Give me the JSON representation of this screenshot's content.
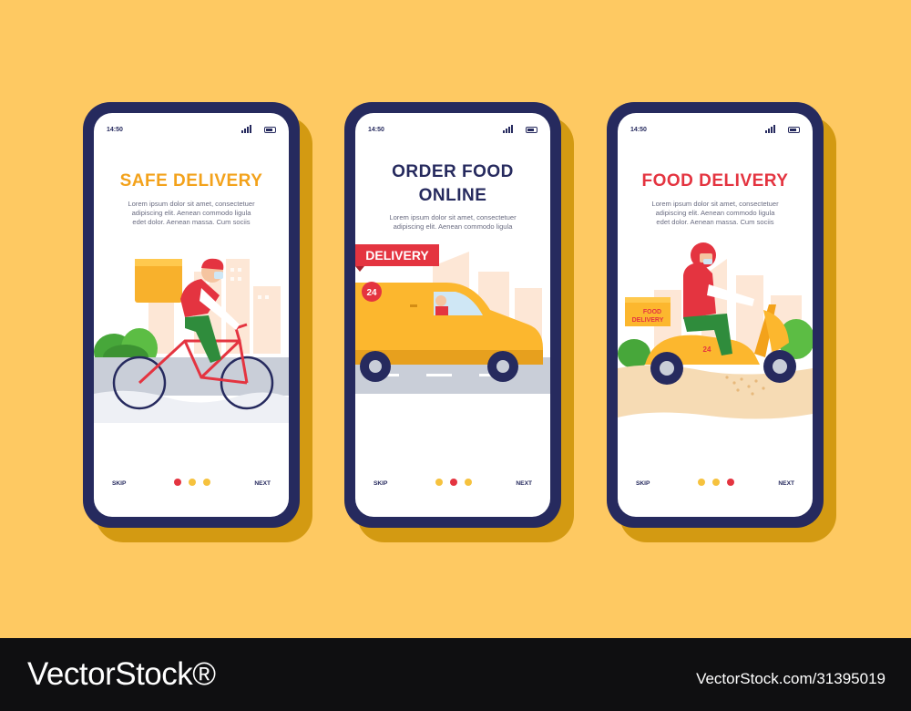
{
  "colors": {
    "background": "#fec962",
    "phone_body": "#262a5e",
    "phone_shadow": "#d39a12",
    "screen": "#ffffff",
    "accent_orange": "#f3a21b",
    "accent_red": "#e43440",
    "navy": "#262a5e",
    "dot_inactive": "#f6c23e",
    "dot_active": "#e43440"
  },
  "screens": [
    {
      "status_time": "14:50",
      "title_lines": [
        "SAFE DELIVERY",
        ""
      ],
      "title_color": "#f3a21b",
      "description_lines": [
        "Lorem ipsum dolor sit amet, consectetuer",
        "adipiscing elit. Aenean commodo ligula",
        "edet dolor. Aenean massa. Cum sociis"
      ],
      "illustration": "bike-courier-illustration",
      "skip_label": "SKIP",
      "next_label": "NEXT",
      "active_dot": 0
    },
    {
      "status_time": "14:50",
      "title_lines": [
        "ORDER FOOD",
        "ONLINE"
      ],
      "title_color": "#262a5e",
      "description_lines": [
        "Lorem ipsum dolor sit amet, consectetuer",
        "adipiscing elit. Aenean commodo ligula",
        ""
      ],
      "illustration": "delivery-van-illustration",
      "van_sign": "DELIVERY",
      "van_badge": "24",
      "skip_label": "SKIP",
      "next_label": "NEXT",
      "active_dot": 1
    },
    {
      "status_time": "14:50",
      "title_lines": [
        "FOOD DELIVERY",
        ""
      ],
      "title_color": "#e43440",
      "description_lines": [
        "Lorem ipsum dolor sit amet, consectetuer",
        "adipiscing elit. Aenean commodo ligula",
        "edet dolor. Aenean massa. Cum sociis"
      ],
      "illustration": "scooter-courier-illustration",
      "box_label_line1": "FOOD",
      "box_label_line2": "DELIVERY",
      "scooter_badge": "24",
      "skip_label": "SKIP",
      "next_label": "NEXT",
      "active_dot": 2
    }
  ],
  "watermark": {
    "logo": "VectorStock®",
    "url": "VectorStock.com/31395019"
  }
}
